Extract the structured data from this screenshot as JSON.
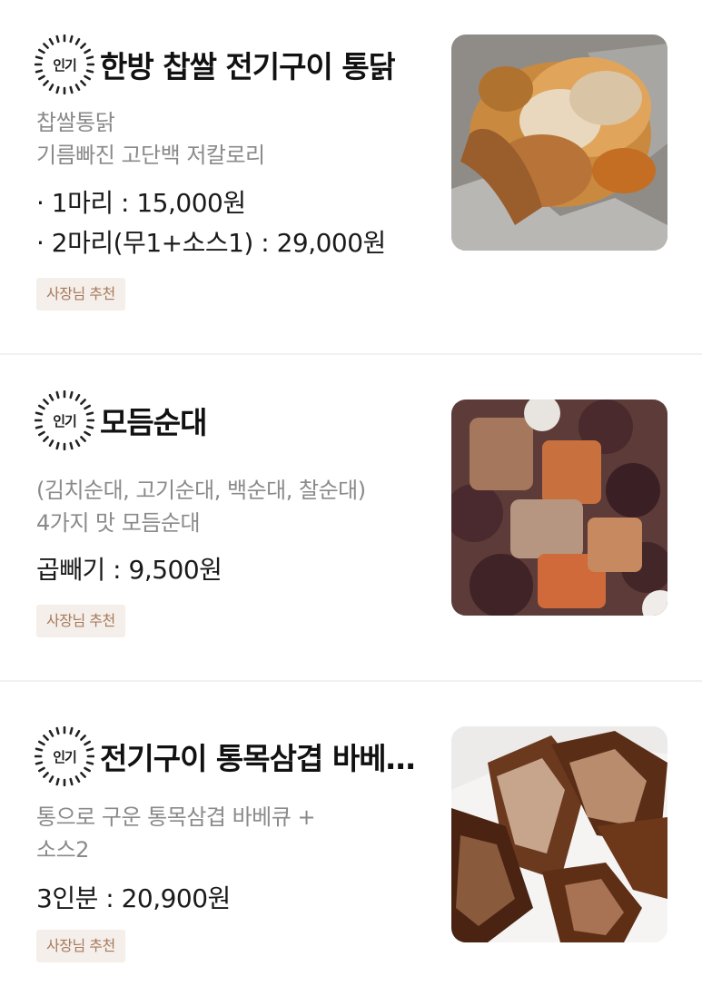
{
  "menu": {
    "items": [
      {
        "badge": "인기",
        "title": "한방 찹쌀 전기구이 통닭",
        "desc_lines": [
          "찹쌀통닭",
          "기름빠진 고단백 저칼로리"
        ],
        "prices": [
          "· 1마리 : 15,000원",
          "· 2마리(무1+소스1) : 29,000원"
        ],
        "tag": "사장님 추천",
        "photo_icon": "roast-chicken-photo"
      },
      {
        "badge": "인기",
        "title": "모듬순대",
        "desc_lines": [
          "(김치순대, 고기순대, 백순대, 찰순대)",
          "4가지 맛 모듬순대"
        ],
        "prices": [
          "곱빼기 : 9,500원"
        ],
        "tag": "사장님 추천",
        "photo_icon": "assorted-sundae-photo"
      },
      {
        "badge": "인기",
        "title": "전기구이 통목삼겹 바베…",
        "desc_lines": [
          "통으로 구운 통목삼겹 바베큐 +",
          "소스2"
        ],
        "prices": [
          "3인분 : 20,900원"
        ],
        "tag": "사장님 추천",
        "photo_icon": "pork-barbecue-photo"
      }
    ]
  },
  "colors": {
    "tag_bg": "#f4efea",
    "tag_text": "#a8795b",
    "desc_text": "#8a8a8a",
    "divider": "#f1f1f1"
  }
}
